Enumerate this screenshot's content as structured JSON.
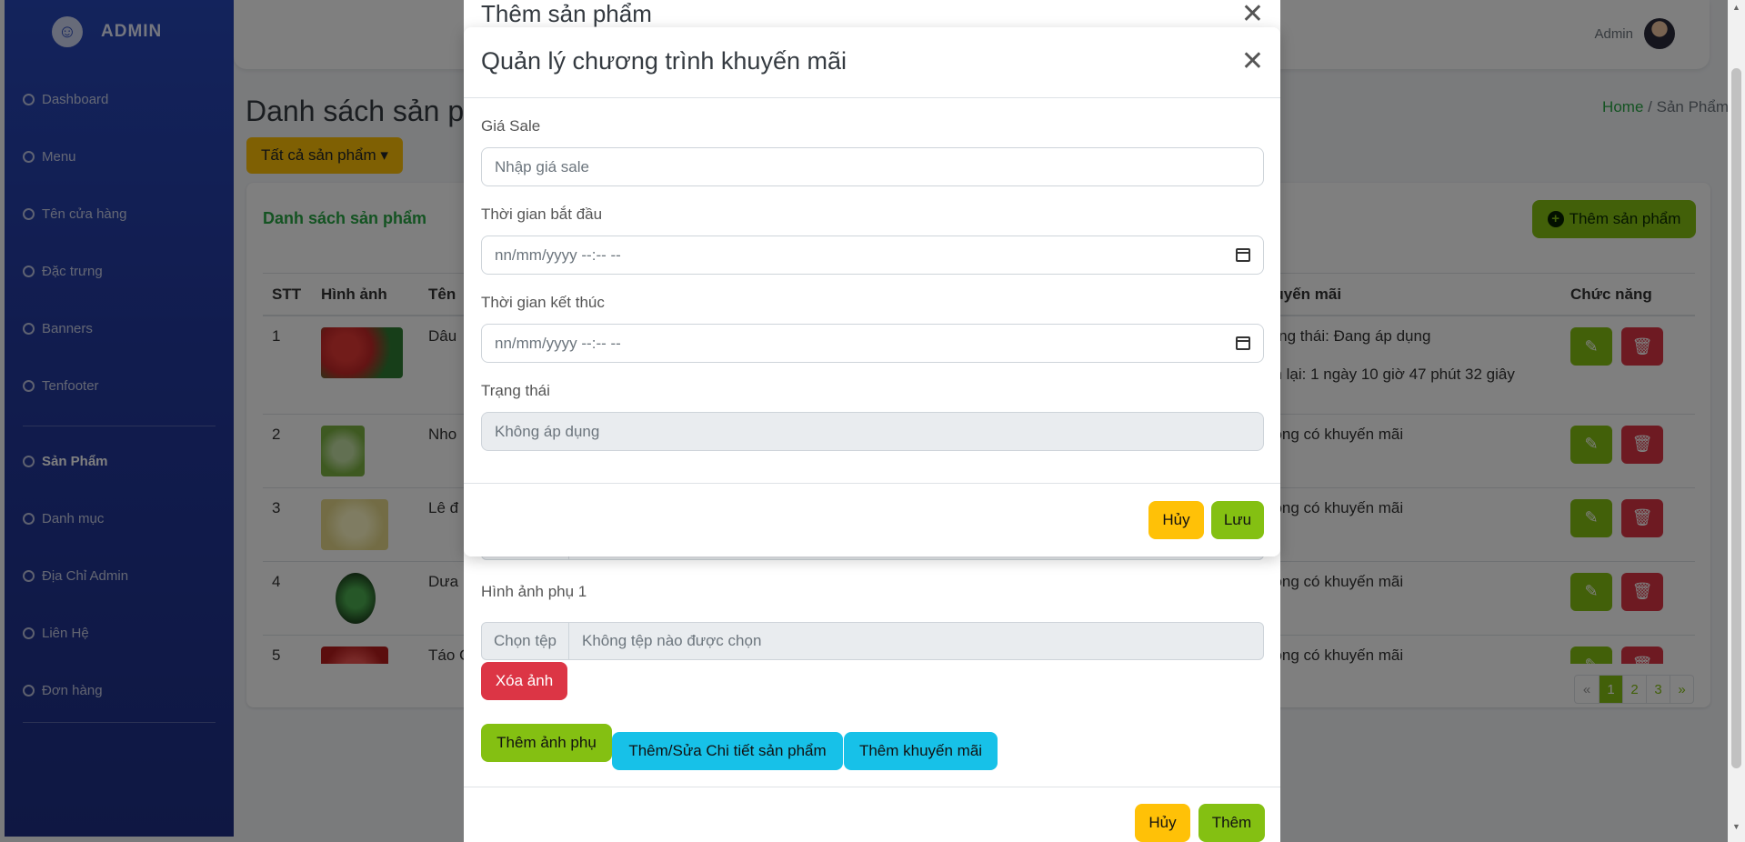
{
  "brand": {
    "name": "ADMIN",
    "logo_glyph": "☺"
  },
  "sidebar": {
    "items": [
      {
        "label": "Dashboard"
      },
      {
        "label": "Menu"
      },
      {
        "label": "Tên cửa hàng"
      },
      {
        "label": "Đặc trưng"
      },
      {
        "label": "Banners"
      },
      {
        "label": "Tenfooter"
      },
      {
        "label": "Sản Phẩm"
      },
      {
        "label": "Danh mục"
      },
      {
        "label": "Địa Chỉ Admin"
      },
      {
        "label": "Liên Hệ"
      },
      {
        "label": "Đơn hàng"
      }
    ]
  },
  "topbar": {
    "user": "Admin"
  },
  "page": {
    "title": "Danh sách sản p",
    "breadcrumb_home": "Home",
    "breadcrumb_sep": "/",
    "breadcrumb_current": "Sản Phẩm",
    "filter_label": "Tất cả sản phẩm ▾"
  },
  "card": {
    "title": "Danh sách sản phẩm",
    "add_label": "Thêm sản phẩm",
    "columns": [
      "STT",
      "Hình ảnh",
      "Tên",
      "",
      "huyến mãi",
      "Chức năng"
    ],
    "rows": [
      {
        "stt": "1",
        "name": "Dâu",
        "promo": "rạng thái: Đang áp dụng",
        "promo2": "òn lại: 1 ngày 10 giờ 47 phút 32 giây"
      },
      {
        "stt": "2",
        "name": "Nho",
        "promo": "hông có khuyến mãi",
        "promo2": ""
      },
      {
        "stt": "3",
        "name": "Lê đ",
        "promo": "hông có khuyến mãi",
        "promo2": ""
      },
      {
        "stt": "4",
        "name": "Dưa",
        "promo": "hông có khuyến mãi",
        "promo2": ""
      },
      {
        "stt": "5",
        "name": "Táo C",
        "promo": "hông có khuyến mãi",
        "promo2": ""
      }
    ],
    "pager": [
      "«",
      "1",
      "2",
      "3",
      "»"
    ]
  },
  "modal_product": {
    "title": "Thêm sản phẩm",
    "file_choose": "Chọn tệp",
    "file_none": "Không tệp nào được chọn",
    "sub_image_label": "Hình ảnh phụ 1",
    "delete_image": "Xóa ảnh",
    "add_sub_image": "Thêm ảnh phụ",
    "edit_detail": "Thêm/Sửa Chi tiết sản phẩm",
    "add_promo": "Thêm khuyến mãi",
    "cancel": "Hủy",
    "submit": "Thêm"
  },
  "modal_promo": {
    "title": "Quản lý chương trình khuyến mãi",
    "sale_label": "Giá Sale",
    "sale_placeholder": "Nhập giá sale",
    "start_label": "Thời gian bắt đầu",
    "start_value": "nn/mm/yyyy --:-- --",
    "end_label": "Thời gian kết thúc",
    "end_value": "nn/mm/yyyy --:-- --",
    "status_label": "Trạng thái",
    "status_value": "Không áp dụng",
    "cancel": "Hủy",
    "save": "Lưu"
  },
  "colors": {
    "sidebar": "#2747b8",
    "accent_green": "#84c012",
    "warning": "#ffc107",
    "danger": "#dc3545",
    "info": "#17c1e8"
  }
}
